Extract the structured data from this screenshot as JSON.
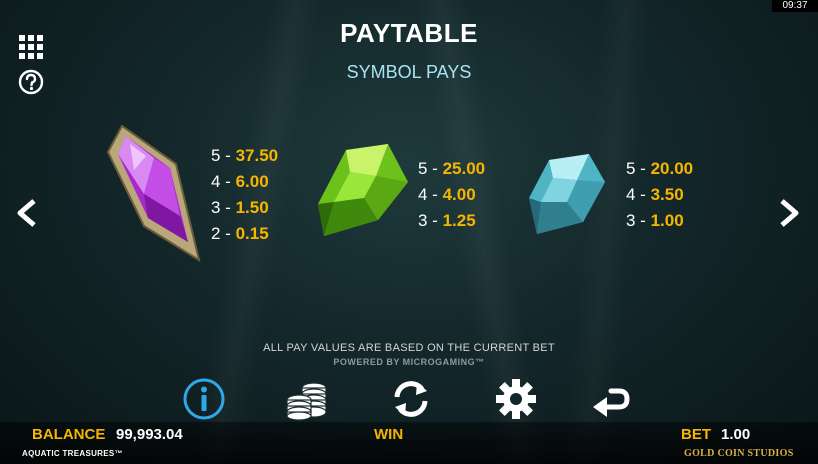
{
  "clock": "09:37",
  "title": "PAYTABLE",
  "subtitle": "SYMBOL PAYS",
  "symbols": [
    {
      "icon": "purple-gem-icon",
      "color": "#b14bd4",
      "pays": [
        {
          "k": "5 - ",
          "v": "37.50"
        },
        {
          "k": "4 - ",
          "v": "6.00"
        },
        {
          "k": "3 - ",
          "v": "1.50"
        },
        {
          "k": "2 - ",
          "v": "0.15"
        }
      ]
    },
    {
      "icon": "green-gem-icon",
      "color": "#7fd21f",
      "pays": [
        {
          "k": "5 - ",
          "v": "25.00"
        },
        {
          "k": "4 - ",
          "v": "4.00"
        },
        {
          "k": "3 - ",
          "v": "1.25"
        }
      ]
    },
    {
      "icon": "blue-gem-icon",
      "color": "#5fc6d6",
      "pays": [
        {
          "k": "5 - ",
          "v": "20.00"
        },
        {
          "k": "4 - ",
          "v": "3.50"
        },
        {
          "k": "3 - ",
          "v": "1.00"
        }
      ]
    }
  ],
  "note": "ALL PAY VALUES ARE BASED ON THE CURRENT BET",
  "powered": "POWERED BY MICROGAMING™",
  "toolbar": [
    "info-icon",
    "coins-icon",
    "refresh-icon",
    "gear-icon",
    "back-arrow-icon"
  ],
  "balance": {
    "label": "BALANCE",
    "value": "99,993.04"
  },
  "win": {
    "label": "WIN"
  },
  "bet": {
    "label": "BET",
    "value": "1.00"
  },
  "game_name": "AQUATIC TREASURES™",
  "studio": "GOLD COIN STUDIOS",
  "colors": {
    "accent": "#f5b500",
    "subtitle": "#a9e3f2",
    "info": "#2ea8e8"
  }
}
